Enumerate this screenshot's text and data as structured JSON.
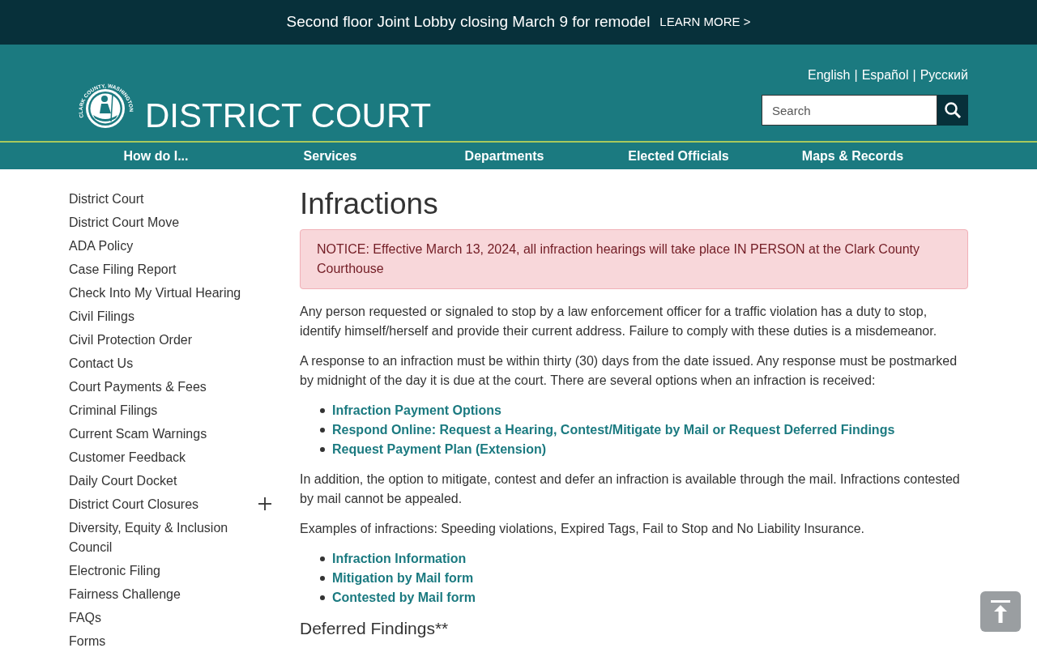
{
  "announcement": {
    "text": "Second floor Joint Lobby closing March 9 for remodel",
    "link": "LEARN MORE >"
  },
  "header": {
    "seal_text": "CLARK COUNTY, WASHINGTON",
    "title": "DISTRICT COURT",
    "languages": [
      "English",
      "Español",
      "Русский"
    ],
    "separator": "|",
    "search": {
      "placeholder": "Search"
    }
  },
  "nav": [
    "How do I...",
    "Services",
    "Departments",
    "Elected Officials",
    "Maps & Records"
  ],
  "sidebar": {
    "items": [
      {
        "label": "District Court"
      },
      {
        "label": "District Court Move"
      },
      {
        "label": "ADA Policy"
      },
      {
        "label": "Case Filing Report"
      },
      {
        "label": "Check Into My Virtual Hearing"
      },
      {
        "label": "Civil Filings"
      },
      {
        "label": "Civil Protection Order"
      },
      {
        "label": "Contact Us"
      },
      {
        "label": "Court Payments & Fees"
      },
      {
        "label": "Criminal Filings"
      },
      {
        "label": "Current Scam Warnings"
      },
      {
        "label": "Customer Feedback"
      },
      {
        "label": "Daily Court Docket"
      },
      {
        "label": "District Court Closures",
        "expanded": false
      },
      {
        "label": "Diversity, Equity & Inclusion Council"
      },
      {
        "label": "Electronic Filing"
      },
      {
        "label": "Fairness Challenge"
      },
      {
        "label": "FAQs"
      },
      {
        "label": "Forms"
      }
    ]
  },
  "main": {
    "title": "Infractions",
    "notice": "NOTICE: Effective March 13, 2024, all infraction hearings will take place IN PERSON at the Clark County Courthouse",
    "blocks": [
      {
        "kind": "paragraph",
        "text": "Any person requested or signaled to stop by a law enforcement officer for a traffic violation has a duty to stop, identify himself/herself and provide their current address. Failure to comply with these duties is a misdemeanor."
      },
      {
        "kind": "paragraph",
        "text": "A response to an infraction must be within thirty (30) days from the date issued. Any response must be postmarked by midnight of the day it is due at the court. There are several options when an infraction is received:"
      },
      {
        "kind": "links",
        "items": [
          "Infraction Payment Options",
          "Respond Online: Request a Hearing, Contest/Mitigate by Mail or Request Deferred Findings",
          "Request Payment Plan (Extension)"
        ]
      },
      {
        "kind": "paragraph",
        "text": "In addition, the option to mitigate, contest and defer an infraction is available through the mail. Infractions contested by mail cannot be appealed."
      },
      {
        "kind": "paragraph",
        "text": "Examples of infractions: Speeding violations, Expired Tags, Fail to Stop and No Liability Insurance."
      },
      {
        "kind": "links",
        "items": [
          "Infraction Information",
          "Mitigation by Mail form",
          "Contested by Mail form"
        ]
      },
      {
        "kind": "heading",
        "text": "Deferred Findings**"
      }
    ]
  }
}
